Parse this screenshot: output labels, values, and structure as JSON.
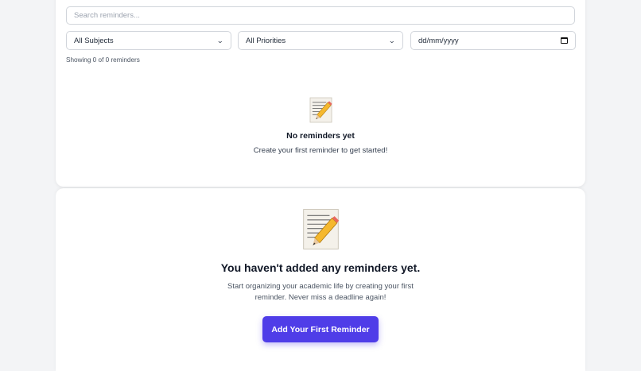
{
  "search": {
    "placeholder": "Search reminders..."
  },
  "filters": {
    "subject": "All Subjects",
    "priority": "All Priorities",
    "date": "dd/mm/yyyy"
  },
  "summary": {
    "showing": "Showing 0 of 0 reminders"
  },
  "empty_list": {
    "icon": "memo-icon",
    "title": "No reminders yet",
    "subtitle": "Create your first reminder to get started!"
  },
  "empty_state": {
    "icon": "memo-icon",
    "title": "You haven't added any reminders yet.",
    "description": "Start organizing your academic life by creating your first reminder. Never miss a deadline again!",
    "cta_label": "Add Your First Reminder"
  },
  "colors": {
    "accent": "#4f3de8",
    "background": "#f3f4f6",
    "card": "#ffffff"
  }
}
